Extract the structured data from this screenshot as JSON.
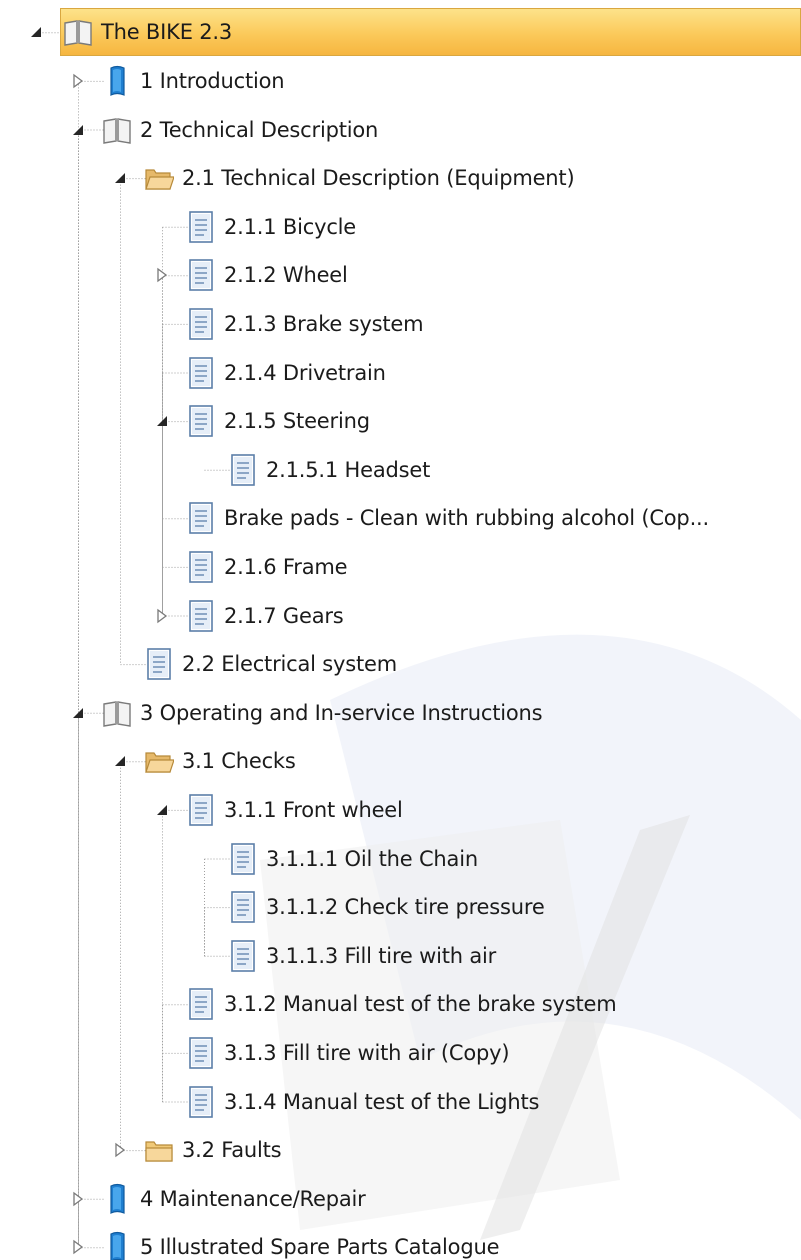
{
  "tree": [
    {
      "label": "The BIKE 2.3",
      "level": 0,
      "icon": "book-open-icon",
      "expander": "expanded",
      "selected": true
    },
    {
      "label": "1 Introduction",
      "level": 1,
      "icon": "book-blue-icon",
      "expander": "collapsed"
    },
    {
      "label": "2 Technical Description",
      "level": 1,
      "icon": "book-open-icon",
      "expander": "expanded"
    },
    {
      "label": "2.1 Technical Description (Equipment)",
      "level": 2,
      "icon": "folder-open-icon",
      "expander": "expanded"
    },
    {
      "label": "2.1.1 Bicycle",
      "level": 3,
      "icon": "document-icon",
      "expander": "none"
    },
    {
      "label": "2.1.2 Wheel",
      "level": 3,
      "icon": "document-icon",
      "expander": "collapsed"
    },
    {
      "label": "2.1.3 Brake system",
      "level": 3,
      "icon": "document-icon",
      "expander": "none"
    },
    {
      "label": "2.1.4 Drivetrain",
      "level": 3,
      "icon": "document-icon",
      "expander": "none"
    },
    {
      "label": "2.1.5 Steering",
      "level": 3,
      "icon": "document-icon",
      "expander": "expanded"
    },
    {
      "label": "2.1.5.1 Headset",
      "level": 4,
      "icon": "document-icon",
      "expander": "none"
    },
    {
      "label": "Brake pads - Clean with rubbing alcohol (Cop...",
      "level": 3,
      "icon": "document-icon",
      "expander": "none"
    },
    {
      "label": "2.1.6 Frame",
      "level": 3,
      "icon": "document-icon",
      "expander": "none"
    },
    {
      "label": "2.1.7 Gears",
      "level": 3,
      "icon": "document-icon",
      "expander": "collapsed"
    },
    {
      "label": "2.2 Electrical system",
      "level": 2,
      "icon": "document-icon",
      "expander": "none"
    },
    {
      "label": "3 Operating and In-service Instructions",
      "level": 1,
      "icon": "book-open-icon",
      "expander": "expanded"
    },
    {
      "label": "3.1 Checks",
      "level": 2,
      "icon": "folder-open-icon",
      "expander": "expanded"
    },
    {
      "label": "3.1.1 Front wheel",
      "level": 3,
      "icon": "document-icon",
      "expander": "expanded"
    },
    {
      "label": "3.1.1.1 Oil the Chain",
      "level": 4,
      "icon": "document-icon",
      "expander": "none"
    },
    {
      "label": "3.1.1.2 Check tire pressure",
      "level": 4,
      "icon": "document-icon",
      "expander": "none"
    },
    {
      "label": "3.1.1.3 Fill tire with air",
      "level": 4,
      "icon": "document-icon",
      "expander": "none"
    },
    {
      "label": "3.1.2 Manual test of the brake system",
      "level": 3,
      "icon": "document-icon",
      "expander": "none"
    },
    {
      "label": "3.1.3 Fill tire with air (Copy)",
      "level": 3,
      "icon": "document-icon",
      "expander": "none"
    },
    {
      "label": "3.1.4 Manual test of the Lights",
      "level": 3,
      "icon": "document-icon",
      "expander": "none"
    },
    {
      "label": "3.2 Faults",
      "level": 2,
      "icon": "folder-closed-icon",
      "expander": "collapsed"
    },
    {
      "label": "4 Maintenance/Repair",
      "level": 1,
      "icon": "book-blue-icon",
      "expander": "collapsed"
    },
    {
      "label": "5 Illustrated Spare Parts Catalogue",
      "level": 1,
      "icon": "book-blue-icon",
      "expander": "collapsed"
    }
  ],
  "colors": {
    "selection": "#f9c450",
    "tree_line": "#a0a0a0",
    "text": "#1b1b1b"
  }
}
